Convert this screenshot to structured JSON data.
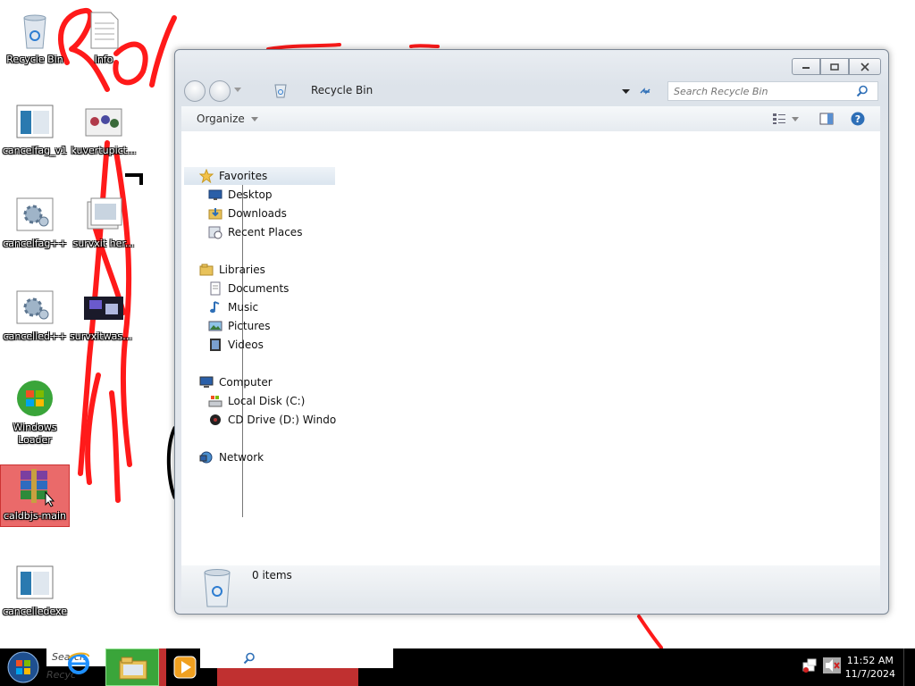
{
  "desktop": {
    "icons": [
      {
        "label": "Recycle Bin"
      },
      {
        "label": "Info"
      },
      {
        "label": "cancelfag_v1"
      },
      {
        "label": "kuvertupict..."
      },
      {
        "label": "cancelfag++"
      },
      {
        "label": "survxit her..."
      },
      {
        "label": "cancelled++"
      },
      {
        "label": "survxitwash..."
      },
      {
        "label": "Windows Loader"
      },
      {
        "label": "caldbjs-main"
      },
      {
        "label": "cancelledexe"
      }
    ]
  },
  "window": {
    "address": "Recycle Bin",
    "search_placeholder": "Search Recycle Bin",
    "toolbar": {
      "organize": "Organize"
    },
    "nav": {
      "favorites": "Favorites",
      "desktop": "Desktop",
      "downloads": "Downloads",
      "recent": "Recent Places",
      "libraries": "Libraries",
      "documents": "Documents",
      "music": "Music",
      "pictures": "Pictures",
      "videos": "Videos",
      "computer": "Computer",
      "local_disk": "Local Disk (C:)",
      "cd_drive": "CD Drive (D:) Windo",
      "network": "Network"
    },
    "details": {
      "count": "0 items"
    }
  },
  "taskbar": {
    "search_placeholder": "Search Recyc",
    "time": "11:52 AM",
    "date": "11/7/2024"
  },
  "colors": {
    "scribble": "#ff1a1a",
    "selected_icon": "#e65050",
    "taskbar": "#000000"
  }
}
